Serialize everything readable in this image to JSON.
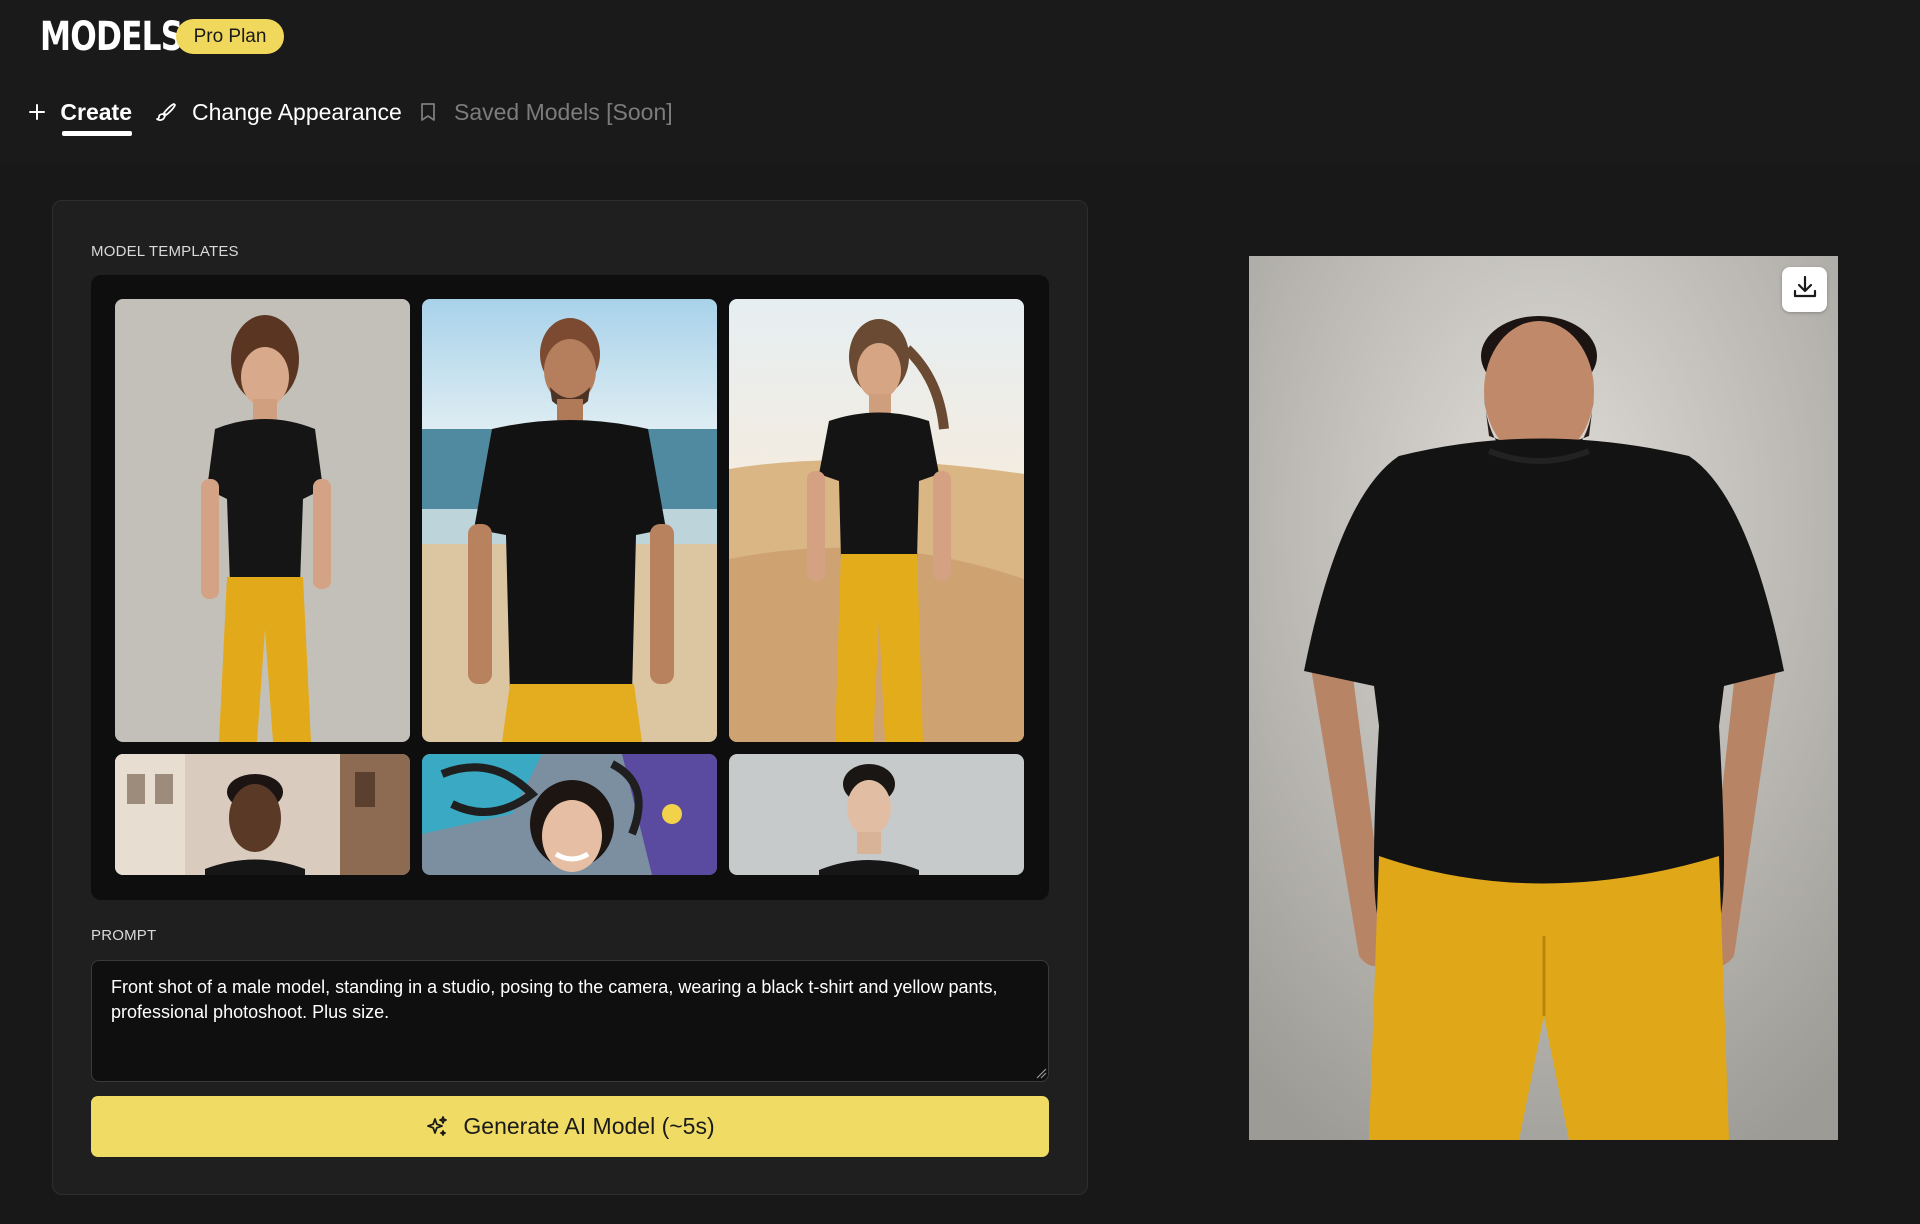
{
  "app": {
    "title": "MODELS",
    "plan_badge": "Pro Plan"
  },
  "tabs": [
    {
      "label": "Create",
      "icon": "plus-icon",
      "state": "active"
    },
    {
      "label": "Change Appearance",
      "icon": "brush-icon",
      "state": "normal"
    },
    {
      "label": "Saved Models [Soon]",
      "icon": "bookmark-icon",
      "state": "disabled"
    }
  ],
  "templates": {
    "label": "MODEL TEMPLATES",
    "items": [
      {
        "name": "woman-studio",
        "icon": "photo"
      },
      {
        "name": "man-beach",
        "icon": "photo"
      },
      {
        "name": "woman-desert",
        "icon": "photo"
      },
      {
        "name": "man-street",
        "icon": "photo"
      },
      {
        "name": "woman-graffiti",
        "icon": "photo"
      },
      {
        "name": "man-studio",
        "icon": "photo"
      }
    ]
  },
  "prompt": {
    "label": "PROMPT",
    "value": "Front shot of a male model, standing in a studio, posing to the camera, wearing a black t-shirt and yellow pants, professional photoshoot. Plus size."
  },
  "generate_button": {
    "label": "Generate AI Model (~5s)",
    "icon": "sparkles-icon"
  },
  "preview": {
    "download_icon": "download-icon"
  },
  "colors": {
    "accent": "#f0dc64",
    "badge": "#f0d85c",
    "background": "#181818",
    "panel": "#1f1f1f",
    "pants": "#e0a818",
    "shirt": "#111111"
  }
}
